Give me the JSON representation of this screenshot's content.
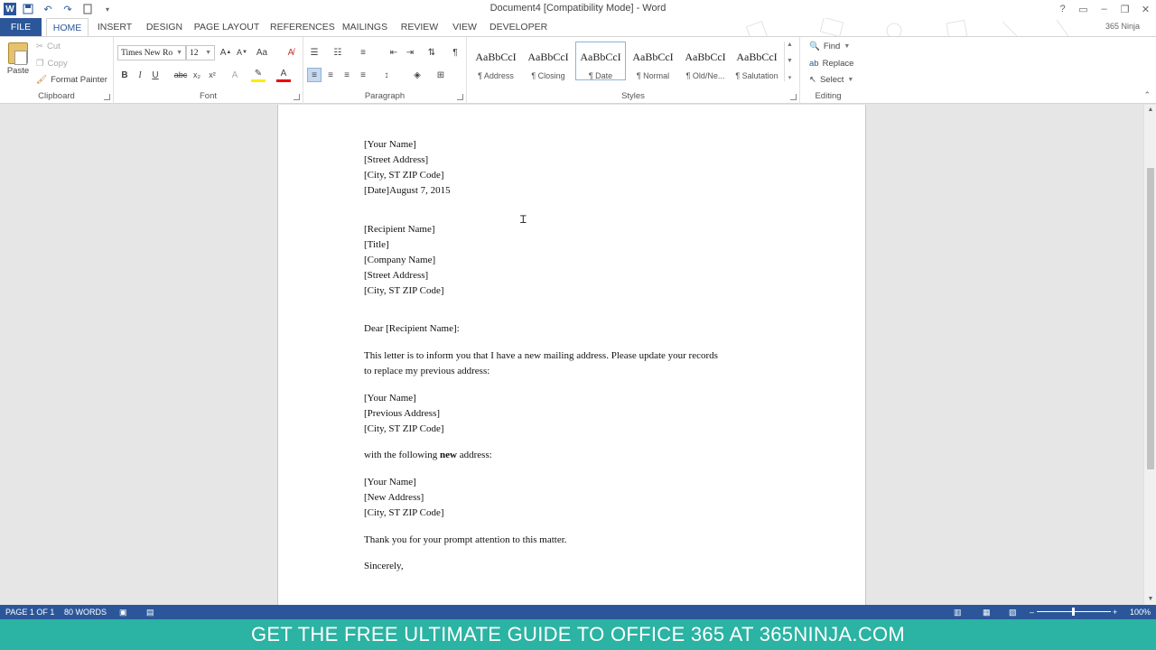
{
  "window": {
    "title": "Document4 [Compatibility Mode] - Word",
    "user": "365 Ninja"
  },
  "tabs": [
    "FILE",
    "HOME",
    "INSERT",
    "DESIGN",
    "PAGE LAYOUT",
    "REFERENCES",
    "MAILINGS",
    "REVIEW",
    "VIEW",
    "DEVELOPER"
  ],
  "active_tab": "HOME",
  "ribbon": {
    "clipboard": {
      "label": "Clipboard",
      "paste": "Paste",
      "cut": "Cut",
      "copy": "Copy",
      "format_painter": "Format Painter"
    },
    "font": {
      "label": "Font",
      "family": "Times New Ro",
      "size": "12"
    },
    "paragraph": {
      "label": "Paragraph"
    },
    "styles": {
      "label": "Styles",
      "sample": "AaBbCcI",
      "items": [
        {
          "sample": "AaBbCcI",
          "name": "¶ Address"
        },
        {
          "sample": "AaBbCcI",
          "name": "¶ Closing"
        },
        {
          "sample": "AaBbCcI",
          "name": "¶ Date"
        },
        {
          "sample": "AaBbCcI",
          "name": "¶ Normal"
        },
        {
          "sample": "AaBbCcI",
          "name": "¶ Old/Ne..."
        },
        {
          "sample": "AaBbCcI",
          "name": "¶ Salutation"
        }
      ],
      "selected": "¶ Date"
    },
    "editing": {
      "label": "Editing",
      "find": "Find",
      "replace": "Replace",
      "select": "Select"
    }
  },
  "document": {
    "lines": [
      "[Your Name]",
      "[Street Address]",
      "[City, ST  ZIP Code]",
      "[Date]August 7, 2015",
      "[Recipient Name]",
      "[Title]",
      "[Company Name]",
      "[Street Address]",
      "[City, ST  ZIP Code]",
      "Dear [Recipient Name]:",
      "This letter is to inform you that I have a new mailing address. Please update your records",
      "to replace my previous address:",
      "[Your Name]",
      "[Previous Address]",
      "[City, ST  ZIP Code]",
      "with the following ",
      "[Your Name]",
      "[New Address]",
      "[City, ST  ZIP Code]",
      "Thank you for your prompt attention to this matter.",
      "Sincerely,"
    ],
    "bold_word": "new",
    "after_bold": " address:"
  },
  "status": {
    "page": "PAGE 1 OF 1",
    "words": "80 WORDS",
    "zoom": "100%"
  },
  "banner": "GET THE FREE ULTIMATE GUIDE TO OFFICE 365 AT 365NINJA.COM",
  "colors": {
    "brand": "#2b579a",
    "banner": "#2bb3a3"
  }
}
